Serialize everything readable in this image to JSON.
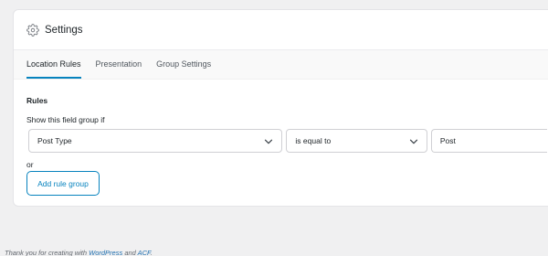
{
  "panel": {
    "title": "Settings",
    "icon": "gear-icon"
  },
  "tabs": [
    {
      "label": "Location Rules",
      "active": true
    },
    {
      "label": "Presentation",
      "active": false
    },
    {
      "label": "Group Settings",
      "active": false
    }
  ],
  "rules": {
    "heading": "Rules",
    "show_label": "Show this field group if",
    "param": "Post Type",
    "operator": "is equal to",
    "value": "Post",
    "or_label": "or",
    "add_group_label": "Add rule group"
  },
  "footer": {
    "prefix": "Thank you for creating with ",
    "wordpress": "WordPress",
    "and": " and ",
    "acf": "ACF",
    "suffix": "."
  },
  "colors": {
    "accent": "#0783be",
    "background": "#f0f0f1"
  }
}
